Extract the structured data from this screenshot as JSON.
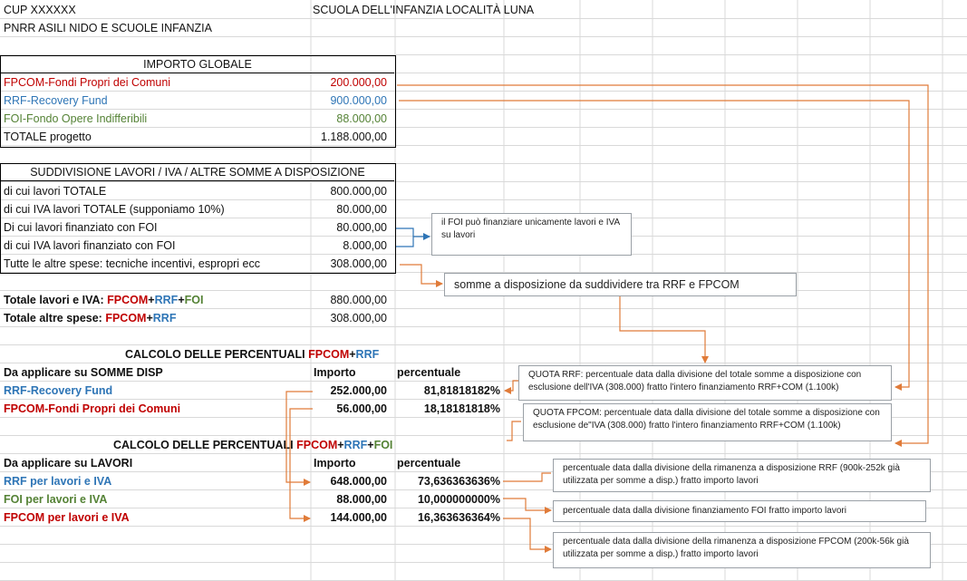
{
  "header": {
    "cup": "CUP XXXXXX",
    "school": "SCUOLA DELL'INFANZIA LOCALITÀ LUNA",
    "pnrr": "PNRR ASILI NIDO E SCUOLE INFANZIA"
  },
  "importo_globale": {
    "title": "IMPORTO GLOBALE",
    "rows": [
      {
        "label": "FPCOM-Fondi Propri dei Comuni",
        "value": "200.000,00"
      },
      {
        "label": "RRF-Recovery Fund",
        "value": "900.000,00"
      },
      {
        "label": "FOI-Fondo Opere Indifferibili",
        "value": "88.000,00"
      },
      {
        "label": "TOTALE progetto",
        "value": "1.188.000,00"
      }
    ]
  },
  "suddivisione": {
    "title": "SUDDIVISIONE LAVORI / IVA / ALTRE SOMME A DISPOSIZIONE",
    "rows": [
      {
        "label": "di cui lavori TOTALE",
        "value": "800.000,00"
      },
      {
        "label": "di cui IVA lavori TOTALE (supponiamo 10%)",
        "value": "80.000,00"
      },
      {
        "label": "Di cui lavori finanziato con FOI",
        "value": "80.000,00"
      },
      {
        "label": "di cui IVA lavori finanziato con FOI",
        "value": "8.000,00"
      },
      {
        "label": "Tutte le altre spese: tecniche incentivi, espropri ecc",
        "value": "308.000,00"
      }
    ]
  },
  "totali": {
    "lavori_iva": {
      "prefix": "Totale lavori e IVA: ",
      "fpcom": "FPCOM",
      "plus1": "+",
      "rrf": "RRF",
      "plus2": "+",
      "foi": "FOI",
      "value": "880.000,00"
    },
    "altre_spese": {
      "prefix": "Totale altre spese: ",
      "fpcom": "FPCOM",
      "plus1": "+",
      "rrf": "RRF",
      "value": "308.000,00"
    }
  },
  "calcolo1": {
    "title_prefix": "CALCOLO DELLE PERCENTUALI ",
    "fpcom": "FPCOM",
    "plus": "+",
    "rrf": "RRF",
    "header_label": "Da applicare su SOMME DISP",
    "header_importo": "Importo",
    "header_perc": "percentuale",
    "rows": [
      {
        "label": "RRF-Recovery Fund",
        "importo": "252.000,00",
        "perc": "81,81818182%"
      },
      {
        "label": "FPCOM-Fondi Propri dei Comuni",
        "importo": "56.000,00",
        "perc": "18,18181818%"
      }
    ]
  },
  "calcolo2": {
    "title_prefix": "CALCOLO DELLE PERCENTUALI ",
    "fpcom": "FPCOM",
    "plus1": "+",
    "rrf": "RRF",
    "plus2": "+",
    "foi": "FOI",
    "header_label": "Da applicare su LAVORI",
    "header_importo": "Importo",
    "header_perc": "percentuale",
    "rows": [
      {
        "label": "RRF per lavori e IVA",
        "importo": "648.000,00",
        "perc": "73,636363636%"
      },
      {
        "label": "FOI per lavori e IVA",
        "importo": "88.000,00",
        "perc": "10,000000000%"
      },
      {
        "label": "FPCOM per lavori e IVA",
        "importo": "144.000,00",
        "perc": "16,363636364%"
      }
    ]
  },
  "notes": {
    "foi": "il FOI può finanziare unicamente lavori e IVA su lavori",
    "somme": "somme a disposizione da suddividere tra RRF e FPCOM",
    "quota_rrf": "QUOTA RRF: percentuale data dalla divisione del totale somme a disposizione con esclusione dell'IVA (308.000) fratto l'intero finanziamento RRF+COM (1.100k)",
    "quota_fpcom": "QUOTA FPCOM: percentuale data dalla divisione del totale somme a disposizione con esclusione de\"IVA (308.000) fratto l'intero finanziamento RRF+COM (1.100k)",
    "rrf_lavori": "percentuale data dalla divisione della rimanenza a disposizione RRF (900k-252k già utilizzata per somme a disp.) fratto importo lavori",
    "foi_lavori": "percentuale data dalla divisione finanziamento FOI fratto importo lavori",
    "fpcom_lavori": "percentuale data dalla divisione della rimanenza a disposizione FPCOM (200k-56k già utilizzata per somme a disp.) fratto importo lavori"
  },
  "colors": {
    "arrow": "#e07b39",
    "grid": "#d9d9d9",
    "red": "#c00000",
    "blue": "#2e75b6",
    "green": "#548235"
  }
}
